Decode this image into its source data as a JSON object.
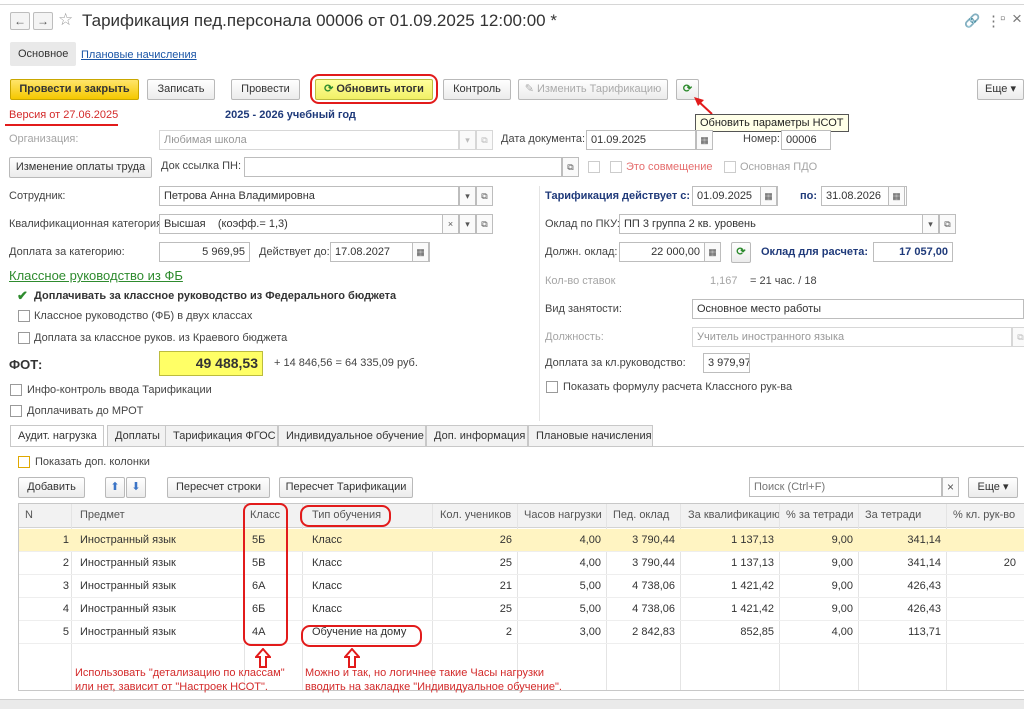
{
  "window": {
    "title": "Тарификация пед.персонала 00006 от 01.09.2025 12:00:00 *"
  },
  "nav": {
    "back": "←",
    "forward": "→",
    "star": "☆"
  },
  "window_icons": {
    "link": "🔗",
    "menu": "⋮",
    "restore": "▫",
    "close": "×"
  },
  "top_tabs": {
    "main": "Основное",
    "planned": "Плановые начисления"
  },
  "toolbar": {
    "post_close": "Провести и закрыть",
    "save": "Записать",
    "post": "Провести",
    "refresh_totals": "Обновить итоги",
    "control": "Контроль",
    "change_tarif": "Изменить Тарификацию",
    "more": "Еще"
  },
  "tooltip": "Обновить параметры НСОТ",
  "version": "Версия от 27.06.2025",
  "school_year": "2025 - 2026 учебный год",
  "org": {
    "label": "Организация:",
    "value": "Любимая школа"
  },
  "doc_date": {
    "label": "Дата документа:",
    "value": "01.09.2025"
  },
  "number": {
    "label": "Номер:",
    "value": "00006"
  },
  "change_pay_button": "Изменение оплаты труда",
  "doc_link": {
    "label": "Док ссылка ПН:",
    "value": ""
  },
  "combination": {
    "label": "Это совмещение"
  },
  "main_pdo": {
    "label": "Основная ПДО"
  },
  "employee": {
    "label": "Сотрудник:",
    "value": "Петрова Анна Владимировна"
  },
  "tarif_period": {
    "label": "Тарификация действует с:",
    "from": "01.09.2025",
    "to_label": "по:",
    "to": "31.08.2026"
  },
  "category": {
    "label": "Квалификационная категория:",
    "value": "Высшая    (коэфф.= 1,3)"
  },
  "pku": {
    "label": "Оклад по ПКУ:",
    "value": "ПП 3 группа 2 кв. уровень"
  },
  "category_pay": {
    "label": "Доплата за категорию:",
    "value": "5 969,95",
    "valid_label": "Действует до:",
    "valid_to": "17.08.2027"
  },
  "salary": {
    "label": "Должн. оклад:",
    "value": "22 000,00",
    "calc_label": "Оклад для расчета:",
    "calc_value": "17 057,00"
  },
  "class_section": {
    "title": "Классное руководство из ФБ"
  },
  "cb_federal": {
    "label": "Доплачивать за классное руководство из Федерального бюджета"
  },
  "cb_two_classes": {
    "label": "Классное руководство (ФБ) в двух классах"
  },
  "cb_regional": {
    "label": "Доплата за классное руков. из Краевого бюджета"
  },
  "rates": {
    "label": "Кол-во ставок",
    "value": "1,167",
    "hours": "= 21 час. / 18"
  },
  "employment": {
    "label": "Вид занятости:",
    "value": "Основное место работы"
  },
  "position": {
    "label": "Должность:",
    "value": "Учитель иностранного языка"
  },
  "fot": {
    "label": "ФОТ:",
    "value": "49 488,53",
    "formula": "+ 14 846,56 = 64 335,09 руб."
  },
  "class_pay": {
    "label": "Доплата за кл.руководство:",
    "value": "3 979,97"
  },
  "cb_info": {
    "label": "Инфо-контроль ввода Тарификации"
  },
  "cb_show_formula": {
    "label": "Показать формулу расчета Классного рук-ва"
  },
  "cb_mrot": {
    "label": "Доплачивать до МРОТ"
  },
  "lower_tabs": [
    "Аудит. нагрузка",
    "Доплаты",
    "Тарификация ФГОС",
    "Индивидуальное обучение",
    "Доп. информация",
    "Плановые начисления"
  ],
  "cb_extra_cols": {
    "label": "Показать доп. колонки"
  },
  "grid_toolbar": {
    "add": "Добавить",
    "up": "⬆",
    "down": "⬇",
    "recalc_rows": "Пересчет строки",
    "recalc_tarif": "Пересчет Тарификации",
    "search_placeholder": "Поиск (Ctrl+F)",
    "clear": "×",
    "more": "Еще"
  },
  "table": {
    "headers": [
      "N",
      "Предмет",
      "Класс",
      "Тип обучения",
      "Кол. учеников",
      "Часов нагрузки",
      "Пед. оклад",
      "За квалификацию",
      "% за тетради",
      "За тетради",
      "% кл. рук-во"
    ],
    "rows": [
      [
        "1",
        "Иностранный язык",
        "5Б",
        "Класс",
        "26",
        "4,00",
        "3 790,44",
        "1 137,13",
        "9,00",
        "341,14",
        ""
      ],
      [
        "2",
        "Иностранный язык",
        "5В",
        "Класс",
        "25",
        "4,00",
        "3 790,44",
        "1 137,13",
        "9,00",
        "341,14",
        "20"
      ],
      [
        "3",
        "Иностранный язык",
        "6А",
        "Класс",
        "21",
        "5,00",
        "4 738,06",
        "1 421,42",
        "9,00",
        "426,43",
        ""
      ],
      [
        "4",
        "Иностранный язык",
        "6Б",
        "Класс",
        "25",
        "5,00",
        "4 738,06",
        "1 421,42",
        "9,00",
        "426,43",
        ""
      ],
      [
        "5",
        "Иностранный язык",
        "4А",
        "Обучение на дому",
        "2",
        "3,00",
        "2 842,83",
        "852,85",
        "4,00",
        "113,71",
        ""
      ]
    ]
  },
  "annotations": {
    "left_line1": "Использовать \"детализацию по классам\"",
    "left_line2": "или нет, зависит от \"Настроек НСОТ\".",
    "right_line1": "Можно и так, но логичнее такие Часы нагрузки",
    "right_line2": "вводить на закладке \"Индивидуальное обучение\"."
  },
  "colors": {
    "accent_red": "#e21b1b",
    "primary_yellow": "#f5c800",
    "link_blue": "#1a55a6",
    "selected_row": "#fff4c2"
  }
}
